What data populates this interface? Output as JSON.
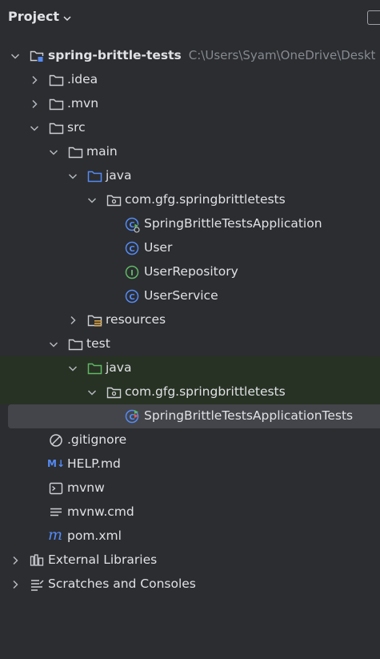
{
  "header": {
    "title": "Project"
  },
  "tree": {
    "root_label": "spring-brittle-tests",
    "root_path": "C:\\Users\\Syam\\OneDrive\\Deskt",
    "idea": ".idea",
    "mvn": ".mvn",
    "src": "src",
    "main": "main",
    "main_java": "java",
    "main_package": "com.gfg.springbrittletests",
    "app_class": "SpringBrittleTestsApplication",
    "user_class": "User",
    "user_repository": "UserRepository",
    "user_service": "UserService",
    "resources": "resources",
    "test": "test",
    "test_java": "java",
    "test_package": "com.gfg.springbrittletests",
    "test_class": "SpringBrittleTestsApplicationTests",
    "gitignore": ".gitignore",
    "help_md": "HELP.md",
    "md_badge": "M↓",
    "mvnw": "mvnw",
    "mvnw_cmd": "mvnw.cmd",
    "pom_icon_letter": "m",
    "pom": "pom.xml",
    "external_libraries": "External Libraries",
    "scratches": "Scratches and Consoles"
  },
  "class_letter": "C",
  "interface_letter": "I",
  "colors": {
    "background": "#2b2d30",
    "text": "#dfe1e5",
    "muted_path": "#868a91",
    "selection": "#43454a",
    "test_highlight": "#283224",
    "java_source_folder": "#548af7",
    "java_test_folder": "#5fb865",
    "class_icon": "#548af7",
    "interface_icon": "#5fb865"
  }
}
